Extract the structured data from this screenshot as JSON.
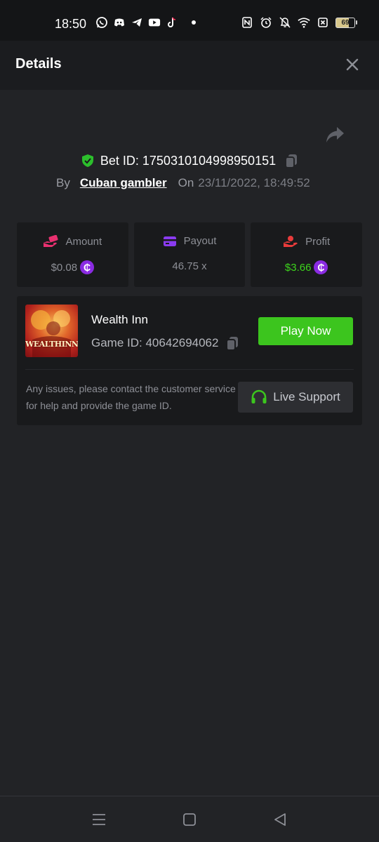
{
  "status_bar": {
    "time": "18:50",
    "battery_level": "69",
    "app_icons": [
      "whatsapp-icon",
      "discord-icon",
      "telegram-icon",
      "youtube-icon",
      "tiktok-icon",
      "dot-icon"
    ],
    "system_icons": [
      "nfc-icon",
      "alarm-icon",
      "bell-off-icon",
      "wifi-icon",
      "sim-off-icon",
      "battery-icon"
    ]
  },
  "header": {
    "title": "Details",
    "close_icon": "close-icon"
  },
  "bet": {
    "share_icon": "share-icon",
    "verified_icon": "shield-check-icon",
    "bet_id_text": "Bet ID: 1750310104998950151",
    "copy_icon": "copy-icon",
    "by_label": "By",
    "user": "Cuban gambler",
    "on_label": "On",
    "date": "23/11/2022, 18:49:52"
  },
  "stats": {
    "amount": {
      "label": "Amount",
      "value": "$0.08",
      "icon": "hand-money-icon",
      "icon_color": "#e8306f"
    },
    "payout": {
      "label": "Payout",
      "value": "46.75 x",
      "icon": "card-icon",
      "icon_color": "#8a3bf0"
    },
    "profit": {
      "label": "Profit",
      "value": "$3.66",
      "icon": "hand-heart-icon",
      "icon_color": "#e83b3b",
      "value_color": "#3dd41c"
    },
    "coin_symbol": "₵"
  },
  "game": {
    "name": "Wealth Inn",
    "thumbnail_logo": "WEALTHINN",
    "game_id_text": "Game ID: 40642694062",
    "play_label": "Play Now",
    "help_text": "Any issues, please contact the customer service for help and provide the game ID.",
    "support_label": "Live Support",
    "support_icon": "headset-icon"
  },
  "nav": {
    "items": [
      "menu-icon",
      "home-icon",
      "back-icon"
    ]
  },
  "colors": {
    "background": "#222326",
    "card": "#191a1c",
    "accent_green": "#3cc51e",
    "coin_purple": "#8a2be2"
  }
}
